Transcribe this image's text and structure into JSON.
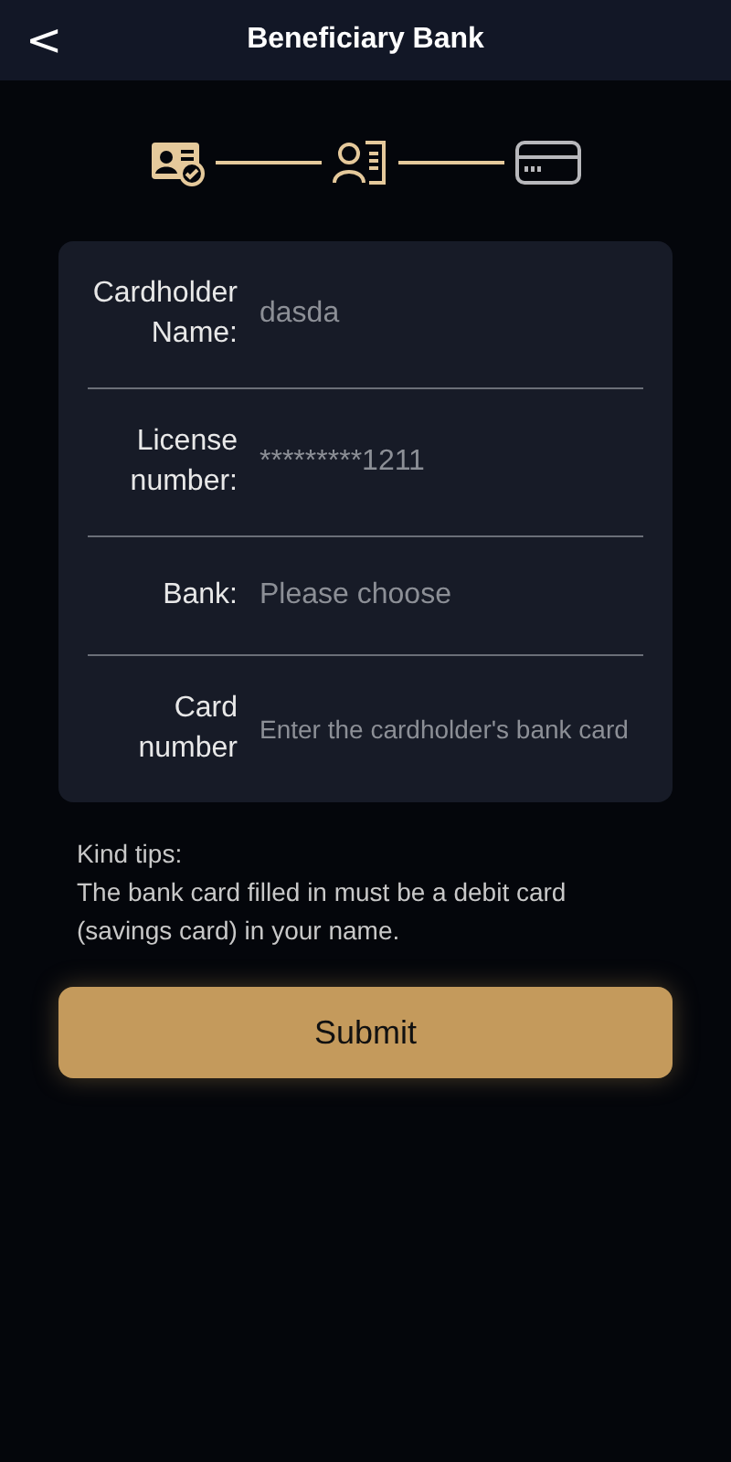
{
  "header": {
    "back": "<",
    "title": "Beneficiary Bank"
  },
  "steps": [
    {
      "done": true
    },
    {
      "done": true
    },
    {
      "done": false
    }
  ],
  "fields": [
    {
      "kind": "input",
      "label": "Cardholder Name:",
      "value": "dasda"
    },
    {
      "kind": "input",
      "label": "License number:",
      "value": "*********1211"
    },
    {
      "kind": "select",
      "label": "Bank:",
      "placeholder": "Please choose"
    },
    {
      "kind": "input",
      "label": "Card number",
      "placeholder": "Enter the cardholder's bank card"
    }
  ],
  "tips": {
    "title": "Kind tips:",
    "text": "The bank card filled in must be a debit card (savings card) in your name."
  },
  "submit": "Submit"
}
